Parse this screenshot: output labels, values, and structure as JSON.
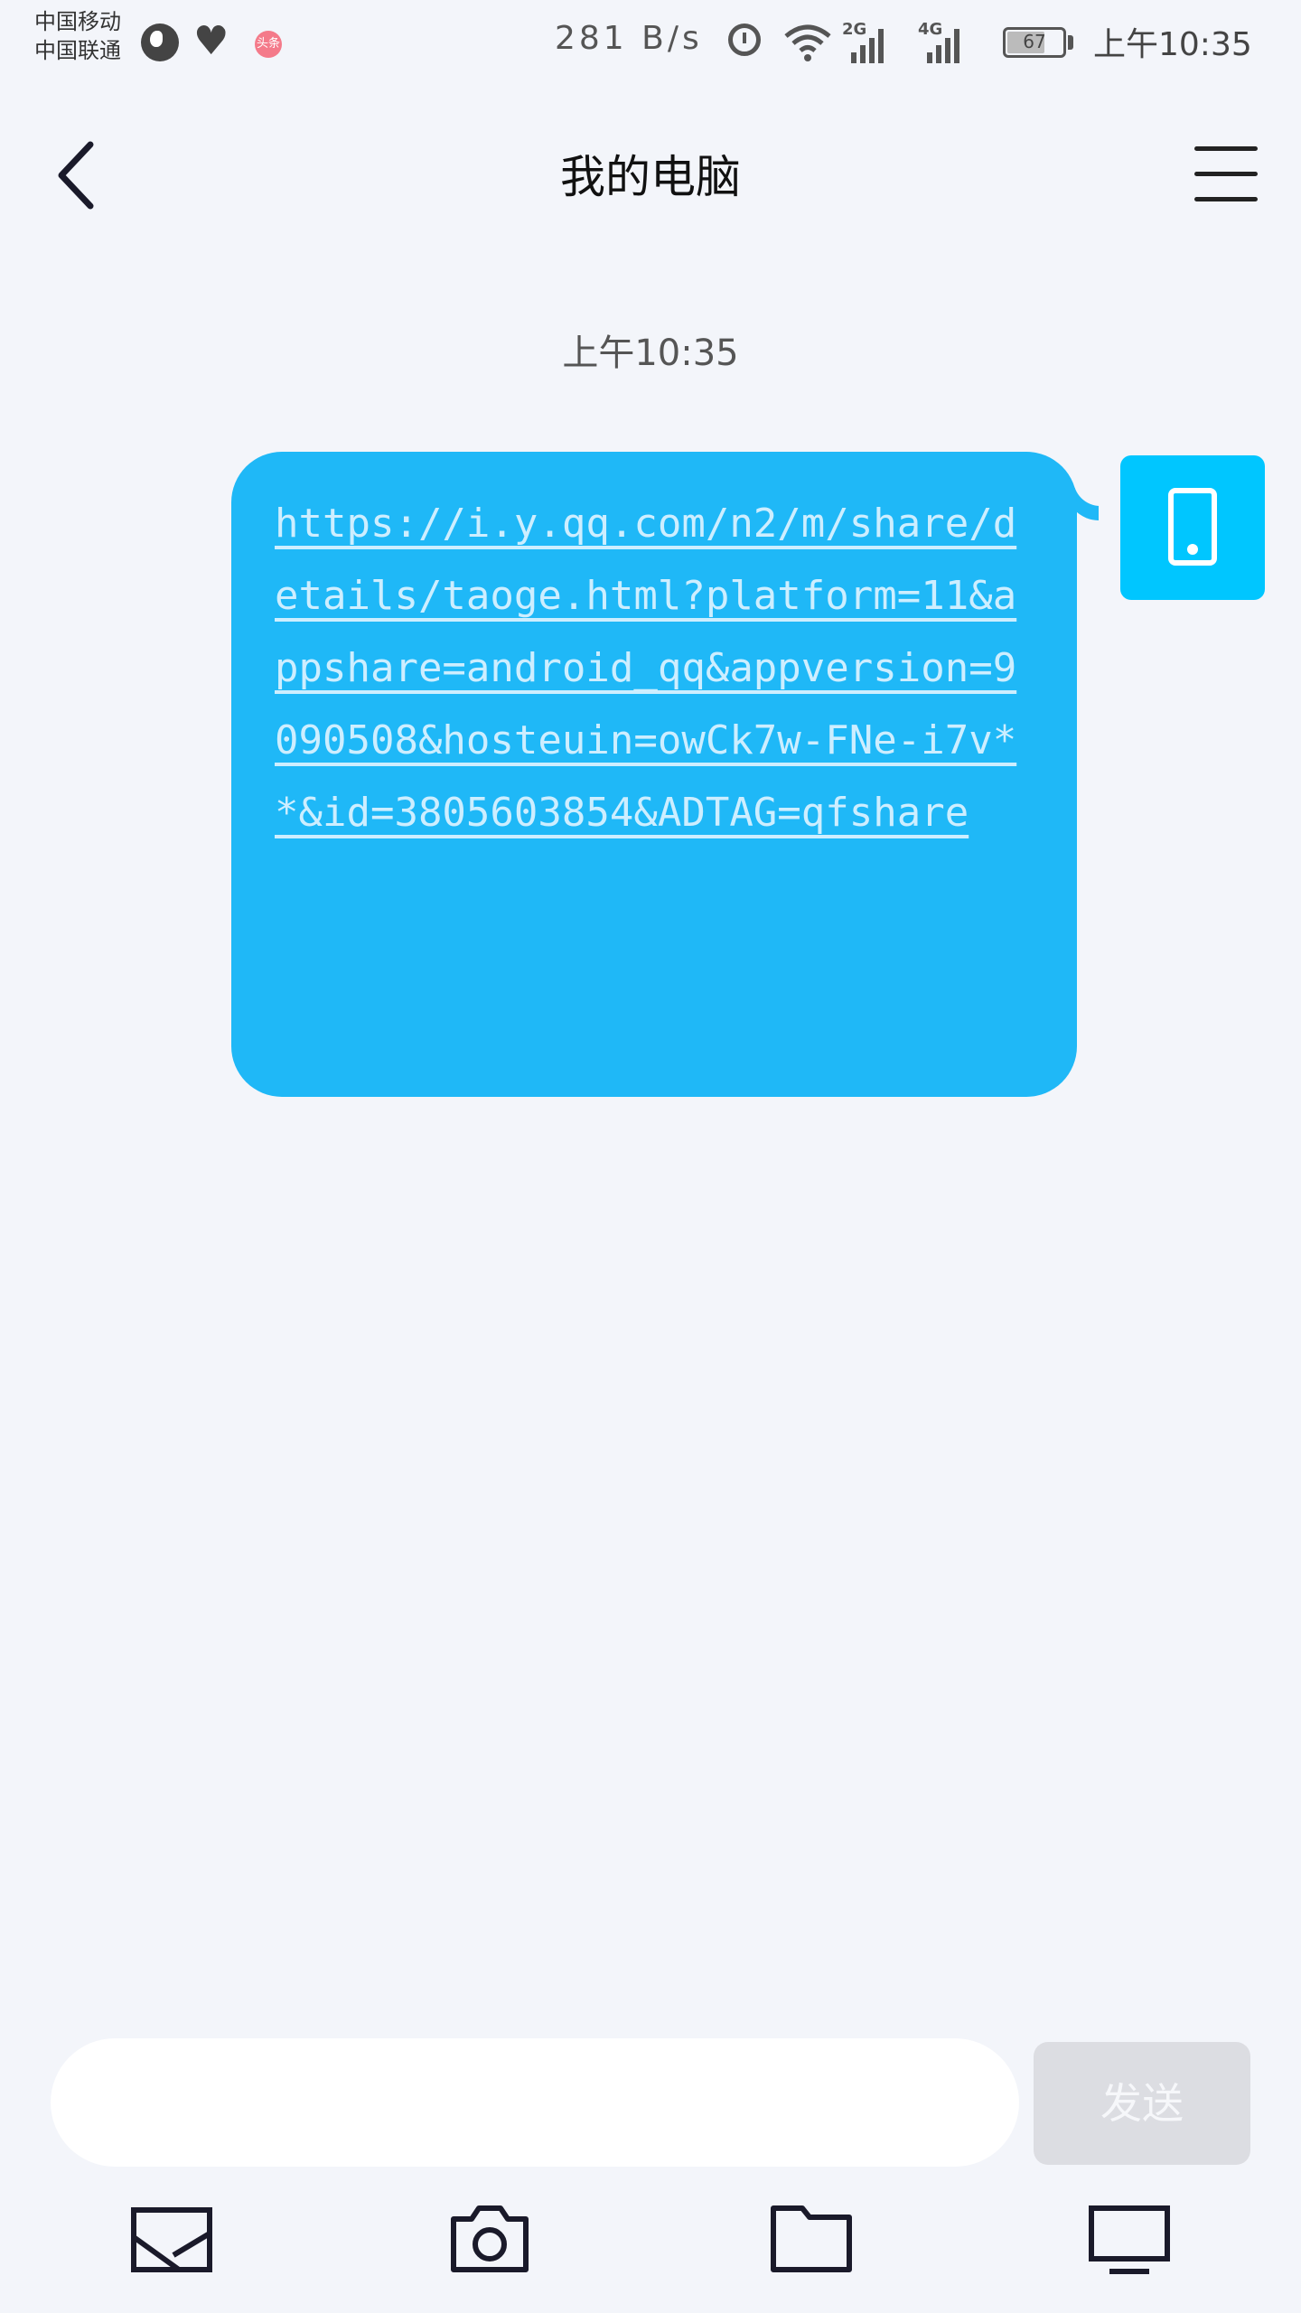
{
  "status_bar": {
    "carrier_1": "中国移动",
    "carrier_2": "中国联通",
    "notification_badge": "头条",
    "net_speed": "281 B/s",
    "signal_1_label": "2G",
    "signal_2_label": "4G",
    "battery_percent": "67",
    "time": "上午10:35",
    "icons": [
      "globe-icon",
      "heart-rate-icon",
      "alarm-icon",
      "wifi-icon",
      "signal-icon",
      "battery-icon"
    ]
  },
  "header": {
    "title": "我的电脑",
    "back_icon": "chevron-left-icon",
    "menu_icon": "hamburger-menu-icon"
  },
  "chat": {
    "timestamp": "上午10:35",
    "messages": [
      {
        "sender": "self",
        "avatar_icon": "phone-icon",
        "text": "https://i.y.qq.com/n2/m/share/details/taoge.html?platform=11&appshare=android_qq&appversion=9090508&hosteuin=owCk7w-FNe-i7v**&id=3805603854&ADTAG=qfshare"
      }
    ]
  },
  "composer": {
    "input_value": "",
    "send_label": "发送"
  },
  "toolbar": {
    "items": [
      "image-icon",
      "camera-icon",
      "folder-icon",
      "computer-icon"
    ]
  },
  "colors": {
    "background": "#f3f5fa",
    "bubble": "#1fb8f7",
    "avatar": "#00c6ff",
    "send_disabled": "#dcdde2"
  }
}
